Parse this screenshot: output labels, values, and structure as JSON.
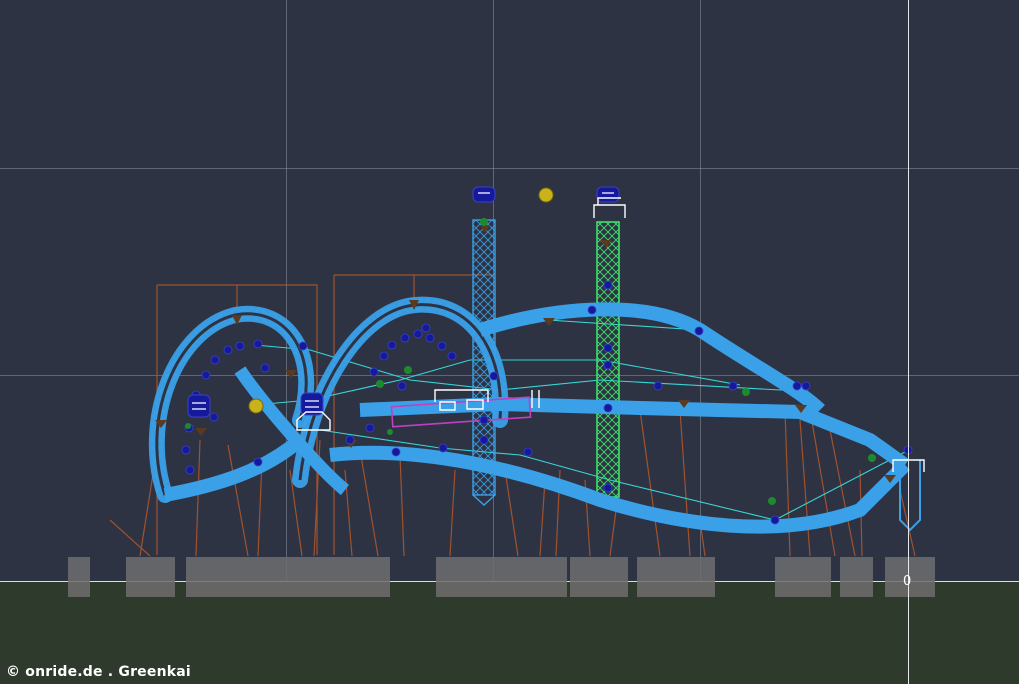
{
  "app": {
    "view": "side-elevation",
    "colors": {
      "background": "#2d3343",
      "ground": "#2e3a2b",
      "track": "#3aa0e8",
      "track_highlight": "#3de06a",
      "supports": "#a0522d",
      "spline": "#37d6d6",
      "nodes": "#151a9c",
      "selection": "#c040c0"
    }
  },
  "overlay": {
    "watermark": "© onride.de . Greenkai",
    "origin_marker": "0"
  }
}
